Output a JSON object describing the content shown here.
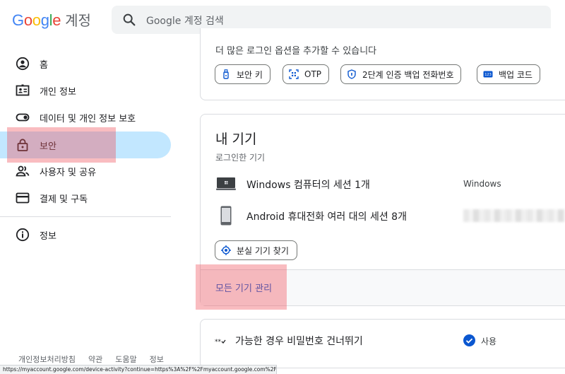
{
  "header": {
    "logo_google": "Google",
    "logo_account": "계정",
    "search_placeholder": "Google 계정 검색"
  },
  "sidebar": {
    "items": [
      {
        "label": "홈",
        "icon": "home-icon"
      },
      {
        "label": "개인 정보",
        "icon": "personal-info-icon"
      },
      {
        "label": "데이터 및 개인 정보 보호",
        "icon": "toggle-icon"
      },
      {
        "label": "보안",
        "icon": "lock-icon",
        "active": true
      },
      {
        "label": "사용자 및 공유",
        "icon": "people-icon"
      },
      {
        "label": "결제 및 구독",
        "icon": "credit-card-icon"
      },
      {
        "label": "정보",
        "icon": "info-icon"
      }
    ],
    "footer": [
      "개인정보처리방침",
      "약관",
      "도움말",
      "정보"
    ]
  },
  "signin_options": {
    "description": "더 많은 로그인 옵션을 추가할 수 있습니다",
    "chips": [
      {
        "label": "보안 키",
        "icon": "security-key-icon"
      },
      {
        "label": "OTP",
        "icon": "qr-code-icon"
      },
      {
        "label": "2단계 인증 백업 전화번호",
        "icon": "shield-icon"
      },
      {
        "label": "백업 코드",
        "icon": "backup-code-icon"
      }
    ]
  },
  "devices": {
    "title": "내 기기",
    "subtitle": "로그인한 기기",
    "rows": [
      {
        "name": "Windows 컴퓨터의 세션 1개",
        "os": "Windows",
        "icon": "laptop-icon"
      },
      {
        "name": "Android 휴대전화 여러 대의 세션 8개",
        "os": "",
        "icon": "phone-icon"
      }
    ],
    "find_button": "분실 기기 찾기",
    "manage_link": "모든 기기 관리"
  },
  "passkey": {
    "label": "가능한 경우 비밀번호 건너뛰기",
    "status": "사용"
  },
  "status_url": "https://myaccount.google.com/device-activity?continue=https%3A%2F%2Fmyaccount.google.com%2Fsecurity%3Fhl%3Dko",
  "colors": {
    "active_nav_bg": "#c2e7ff",
    "link_blue": "#0b57d0",
    "highlight": "#f0505a"
  }
}
